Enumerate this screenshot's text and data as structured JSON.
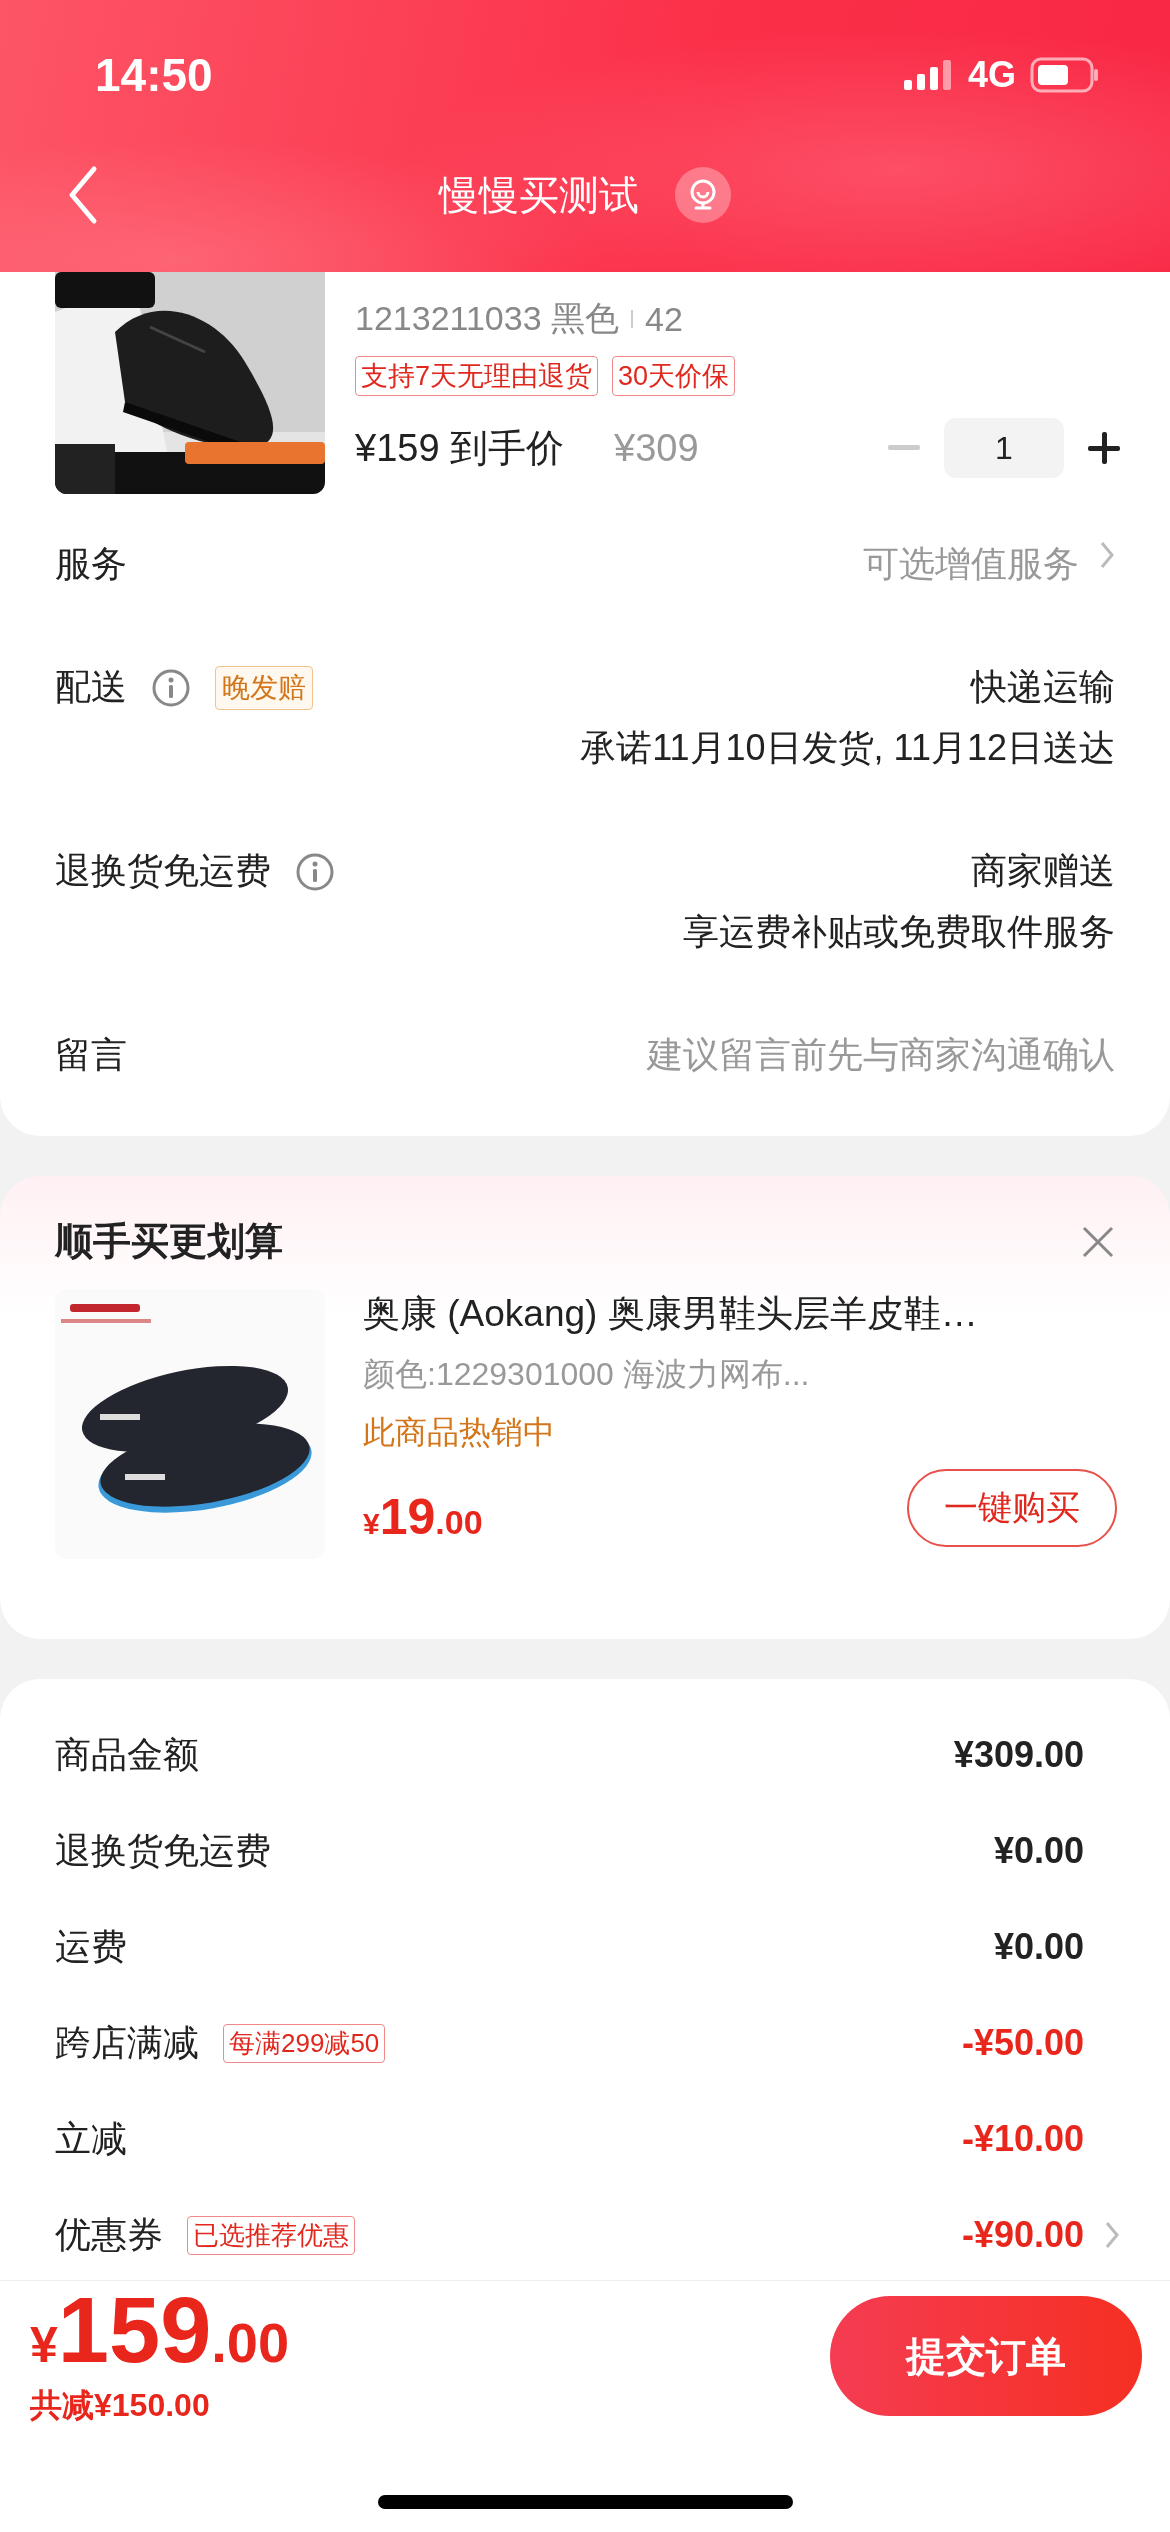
{
  "status_bar": {
    "time": "14:50",
    "network": "4G"
  },
  "nav": {
    "title": "慢慢买测试"
  },
  "product": {
    "spec": "1213211033 黑色",
    "size": "42",
    "tags": [
      "支持7天无理由退货",
      "30天价保"
    ],
    "price": "¥159 到手价",
    "original_price": "¥309",
    "quantity": "1"
  },
  "rows": [
    {
      "label": "服务",
      "info": false,
      "lines": [
        "可选增值服务"
      ],
      "muted": true,
      "chevron": true
    },
    {
      "label": "配送",
      "info": true,
      "badge": "晚发赔",
      "lines": [
        "快递运输",
        "承诺11月10日发货, 11月12日送达"
      ],
      "muted": false,
      "chevron": false
    },
    {
      "label": "退换货免运费",
      "info": true,
      "lines": [
        "商家赠送",
        "享运费补贴或免费取件服务"
      ],
      "muted": false,
      "chevron": false
    },
    {
      "label": "留言",
      "info": false,
      "lines": [
        "建议留言前先与商家沟通确认"
      ],
      "muted": true,
      "chevron": false
    }
  ],
  "recommend": {
    "title": "顺手买更划算",
    "item": {
      "title": "奥康 (Aokang) 奥康男鞋头层羊皮鞋…",
      "spec": "颜色:1229301000 海波力网布...",
      "status": "此商品热销中",
      "currency": "¥",
      "price_int": "19",
      "price_dec": ".00",
      "button": "一键购买"
    }
  },
  "summary": [
    {
      "label": "商品金额",
      "amount": "¥309.00",
      "discount": false,
      "chevron": false
    },
    {
      "label": "退换货免运费",
      "amount": "¥0.00",
      "discount": false,
      "chevron": false
    },
    {
      "label": "运费",
      "amount": "¥0.00",
      "discount": false,
      "chevron": false
    },
    {
      "label": "跨店满减",
      "tag": "每满299减50",
      "amount": "-¥50.00",
      "discount": true,
      "chevron": false
    },
    {
      "label": "立减",
      "amount": "-¥10.00",
      "discount": true,
      "chevron": false
    },
    {
      "label": "优惠券",
      "tag": "已选推荐优惠",
      "amount": "-¥90.00",
      "discount": true,
      "chevron": true
    }
  ],
  "footer": {
    "currency": "¥",
    "amount": "159",
    "decimals": ".00",
    "saved": "共减¥150.00",
    "submit": "提交订单"
  }
}
